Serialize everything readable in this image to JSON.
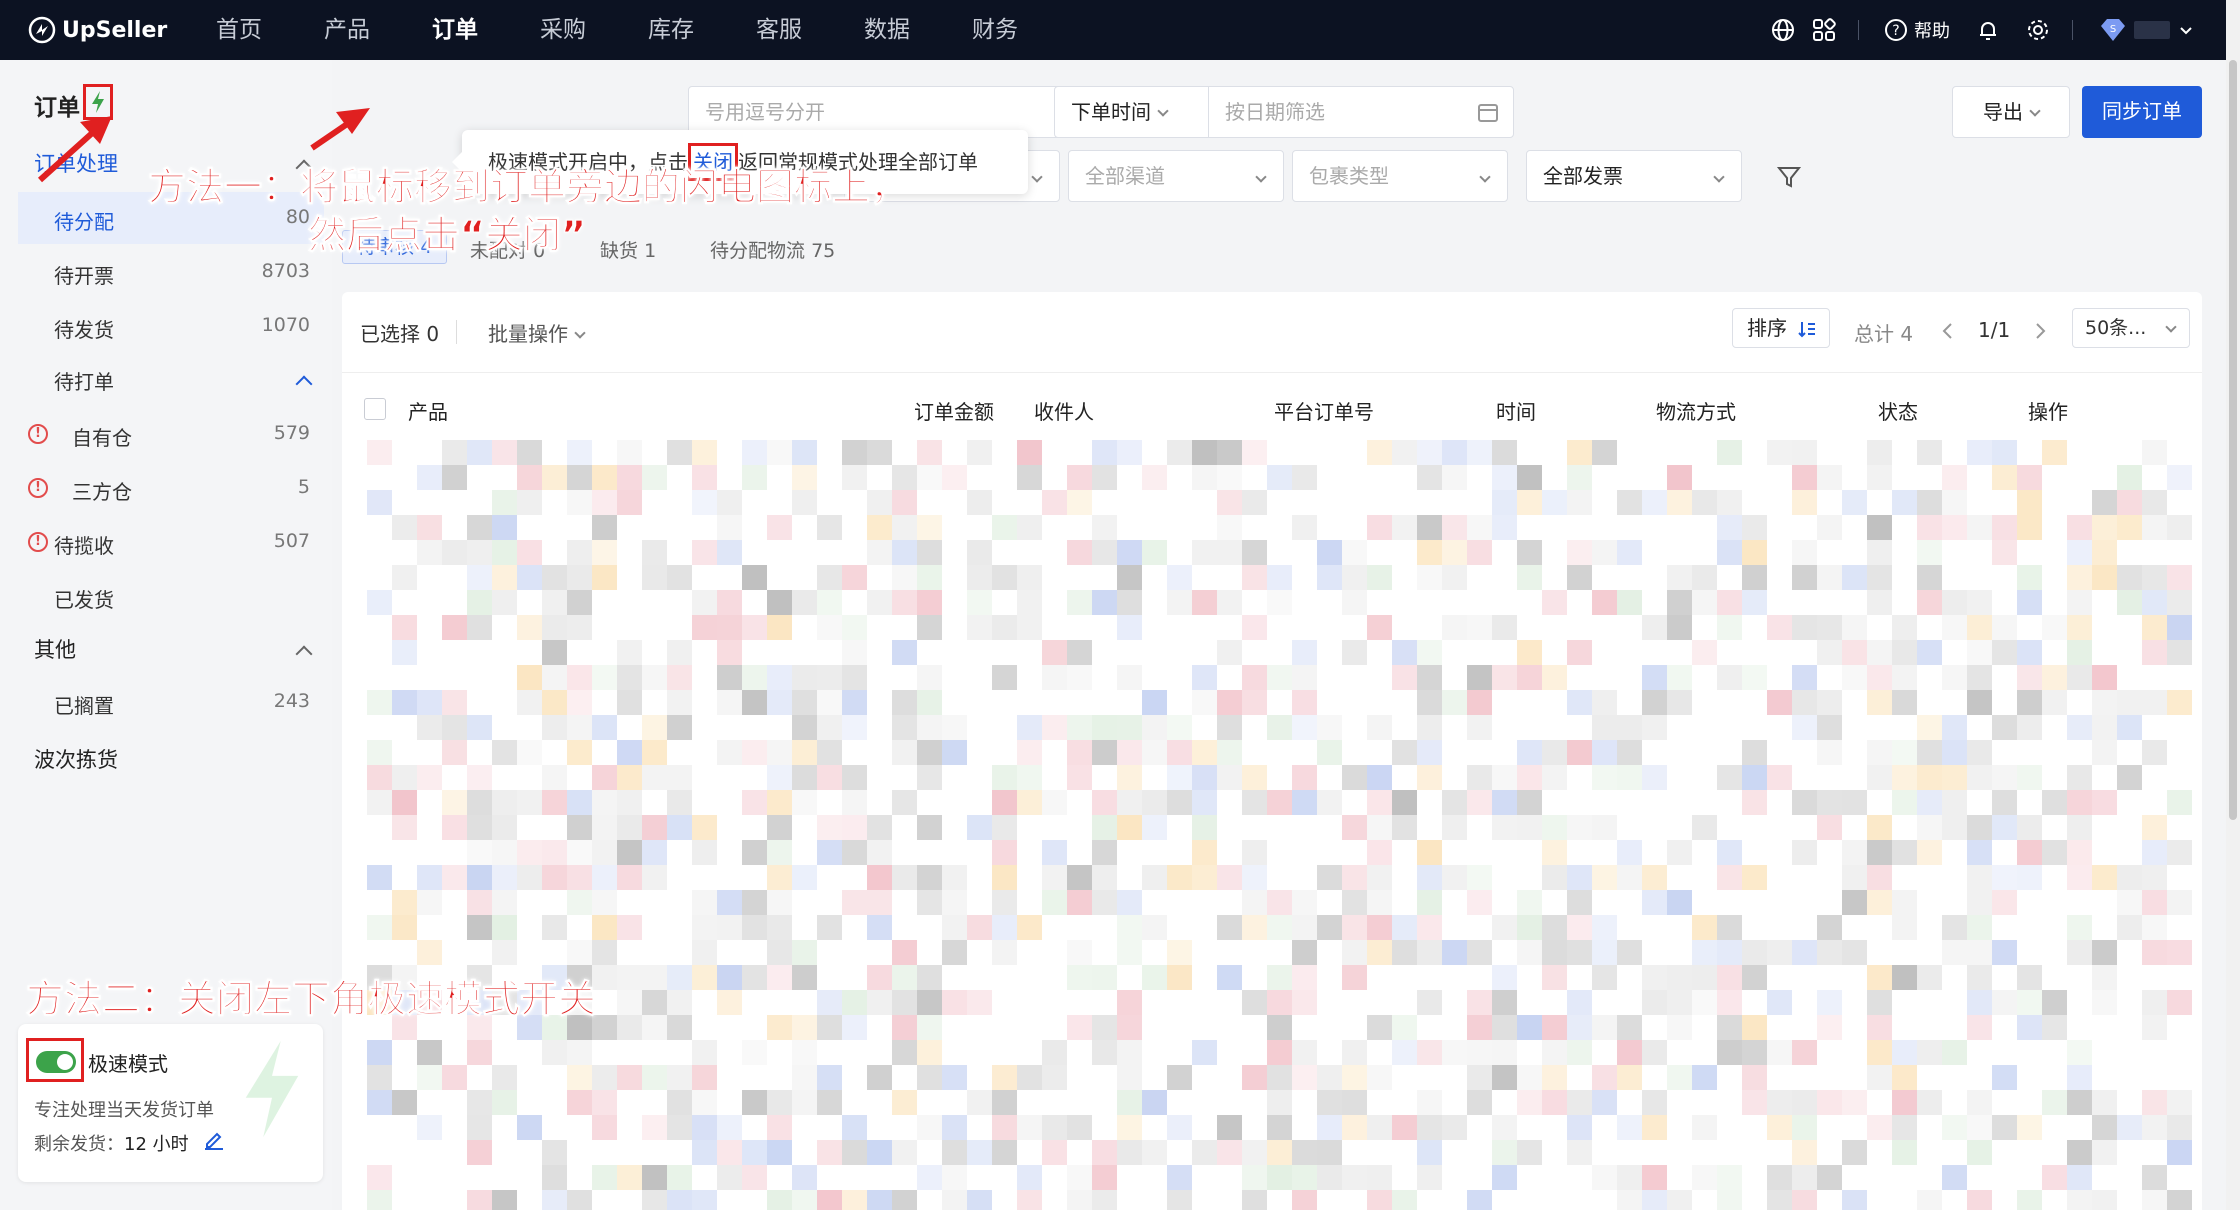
{
  "nav": {
    "brand": "UpSeller",
    "items": [
      {
        "label": "首页"
      },
      {
        "label": "产品"
      },
      {
        "label": "订单"
      },
      {
        "label": "采购"
      },
      {
        "label": "库存"
      },
      {
        "label": "客服"
      },
      {
        "label": "数据"
      },
      {
        "label": "财务"
      }
    ],
    "help_label": "帮助"
  },
  "sidebar": {
    "title": "订单",
    "group_processing": "订单处理",
    "items": [
      {
        "label": "待分配",
        "count": "80"
      },
      {
        "label": "待开票",
        "count": "8703"
      },
      {
        "label": "待发货",
        "count": "1070"
      },
      {
        "label": "待打单",
        "count": ""
      },
      {
        "label": "自有仓",
        "count": "579"
      },
      {
        "label": "三方仓",
        "count": "5"
      },
      {
        "label": "待揽收",
        "count": "507"
      },
      {
        "label": "已发货",
        "count": ""
      }
    ],
    "group_other": "其他",
    "other_items": [
      {
        "label": "已搁置",
        "count": "243"
      },
      {
        "label": "波次拣货",
        "count": ""
      }
    ]
  },
  "speed_mode": {
    "title": "极速模式",
    "description": "专注处理当天发货订单",
    "remaining_label": "剩余发货：",
    "remaining_value": "12 小时"
  },
  "tooltip": {
    "before": "极速模式开启中，点击",
    "link": "关闭",
    "after": "返回常规模式处理全部订单"
  },
  "filters": {
    "search_placeholder": "号用逗号分开",
    "order_time": "下单时间",
    "date_placeholder": "按日期筛选",
    "row2_partial": "全",
    "channel": "全部渠道",
    "package_type": "包裹类型",
    "invoice": "全部发票"
  },
  "actions": {
    "export": "导出",
    "sync": "同步订单"
  },
  "status_tabs": [
    {
      "label": "待审核",
      "count": "4"
    },
    {
      "label": "未配对",
      "count": "0"
    },
    {
      "label": "缺货",
      "count": "1"
    },
    {
      "label": "待分配物流",
      "count": "75"
    }
  ],
  "table_toolbar": {
    "selected": "已选择 0",
    "batch": "批量操作",
    "sort": "排序",
    "total": "总计 4",
    "page": "1/1",
    "page_size": "50条..."
  },
  "columns": [
    "产品",
    "订单金额",
    "收件人",
    "平台订单号",
    "时间",
    "物流方式",
    "状态",
    "操作"
  ],
  "annotations": {
    "method1_line1": "方法一：将鼠标移到订单旁边的闪电图标上，",
    "method1_line2": "然后点击“关闭”",
    "method2": "方法二：关闭左下角极速模式开关"
  },
  "colors": {
    "nav_bg": "#0c1222",
    "accent": "#1f5bd9",
    "annotation": "#e02020",
    "toggle_on": "#3ca34a"
  }
}
